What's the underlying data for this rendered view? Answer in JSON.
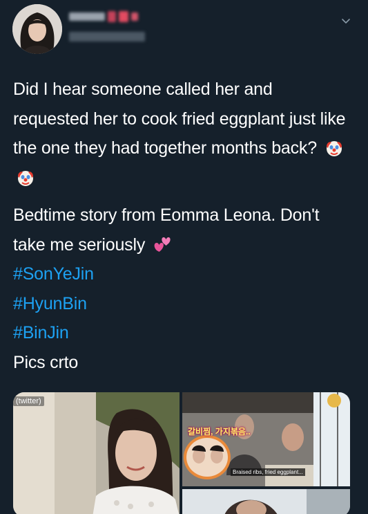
{
  "tweet": {
    "text": {
      "paragraph1": "Did I hear someone called her and requested her to cook fried eggplant just like the one they had together months back?",
      "paragraph2": "Bedtime story from Eomma Leona. Don't take me seriously",
      "hashtags": [
        "#SonYeJin",
        "#HyunBin",
        "#BinJin"
      ],
      "credit": "Pics crto"
    },
    "media": {
      "left_watermark": "(twitter)",
      "korean_caption": "갈비찜, 가지볶음..",
      "sub_caption": "Braised ribs, fried eggplant..."
    },
    "icons": {
      "menu": "chevron-down-icon",
      "emoji_clown": "clown-face-emoji",
      "emoji_hearts": "two-hearts-emoji"
    },
    "colors": {
      "background": "#15202b",
      "text": "#ffffff",
      "hashtag": "#1da1f2",
      "muted": "#8899a6"
    }
  }
}
